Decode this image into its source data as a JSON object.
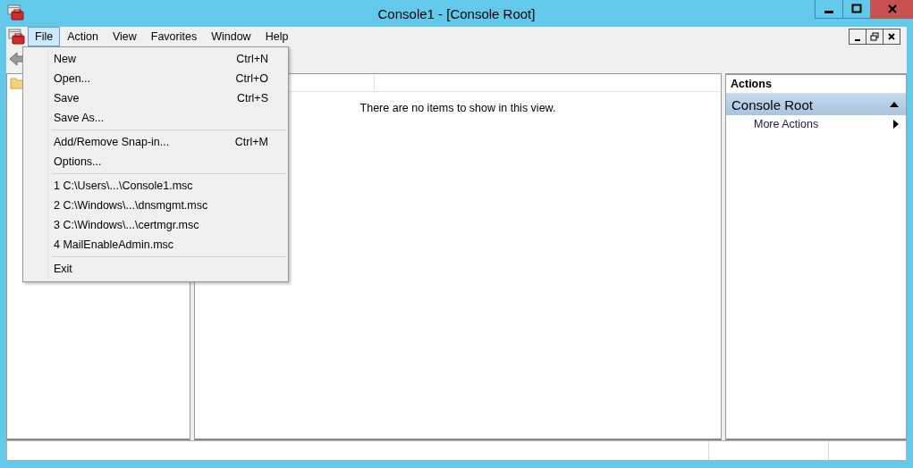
{
  "window": {
    "title": "Console1 - [Console Root]"
  },
  "menu_bar": [
    {
      "label": "File",
      "selected": true
    },
    {
      "label": "Action",
      "selected": false
    },
    {
      "label": "View",
      "selected": false
    },
    {
      "label": "Favorites",
      "selected": false
    },
    {
      "label": "Window",
      "selected": false
    },
    {
      "label": "Help",
      "selected": false
    }
  ],
  "file_menu": [
    {
      "kind": "item",
      "label": "New",
      "shortcut": "Ctrl+N"
    },
    {
      "kind": "item",
      "label": "Open...",
      "shortcut": "Ctrl+O"
    },
    {
      "kind": "item",
      "label": "Save",
      "shortcut": "Ctrl+S"
    },
    {
      "kind": "item",
      "label": "Save As..."
    },
    {
      "kind": "separator"
    },
    {
      "kind": "item",
      "label": "Add/Remove Snap-in...",
      "shortcut": "Ctrl+M"
    },
    {
      "kind": "item",
      "label": "Options..."
    },
    {
      "kind": "separator"
    },
    {
      "kind": "item",
      "label": "1 C:\\Users\\...\\Console1.msc"
    },
    {
      "kind": "item",
      "label": "2 C:\\Windows\\...\\dnsmgmt.msc"
    },
    {
      "kind": "item",
      "label": "3 C:\\Windows\\...\\certmgr.msc"
    },
    {
      "kind": "item",
      "label": "4 MailEnableAdmin.msc"
    },
    {
      "kind": "separator"
    },
    {
      "kind": "item",
      "label": "Exit"
    }
  ],
  "content": {
    "empty_message": "There are no items to show in this view."
  },
  "actions": {
    "header": "Actions",
    "section": {
      "title": "Console Root",
      "expanded": true
    },
    "items": [
      {
        "label": "More Actions"
      }
    ]
  }
}
